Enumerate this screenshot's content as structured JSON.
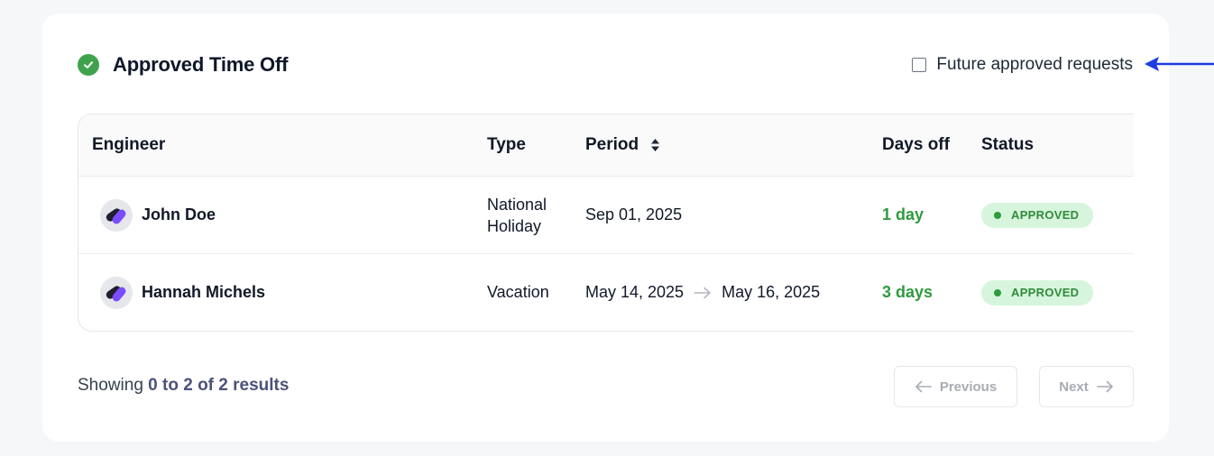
{
  "header": {
    "title": "Approved Time Off",
    "filter_label": "Future approved requests",
    "filter_checked": false
  },
  "table": {
    "columns": {
      "engineer": "Engineer",
      "type": "Type",
      "period": "Period",
      "days_off": "Days off",
      "status": "Status"
    },
    "rows": [
      {
        "engineer": "John Doe",
        "type_line1": "National",
        "type_line2": "Holiday",
        "period_start": "Sep 01, 2025",
        "period_end": "",
        "days_off": "1 day",
        "status": "APPROVED"
      },
      {
        "engineer": "Hannah Michels",
        "type_line1": "Vacation",
        "type_line2": "",
        "period_start": "May 14, 2025",
        "period_end": "May 16, 2025",
        "days_off": "3 days",
        "status": "APPROVED"
      }
    ]
  },
  "footer": {
    "showing_prefix": "Showing",
    "showing_range": "0 to 2 of 2 results",
    "previous_label": "Previous",
    "next_label": "Next"
  },
  "colors": {
    "success": "#3fa34d",
    "badge_bg": "#d7f5dc",
    "annotation_arrow": "#1d3ce0"
  },
  "icons": {
    "title": "check-circle-icon",
    "sort": "sort-icon",
    "period_arrow": "arrow-right-icon",
    "previous": "arrow-left-icon",
    "next": "arrow-right-icon"
  }
}
